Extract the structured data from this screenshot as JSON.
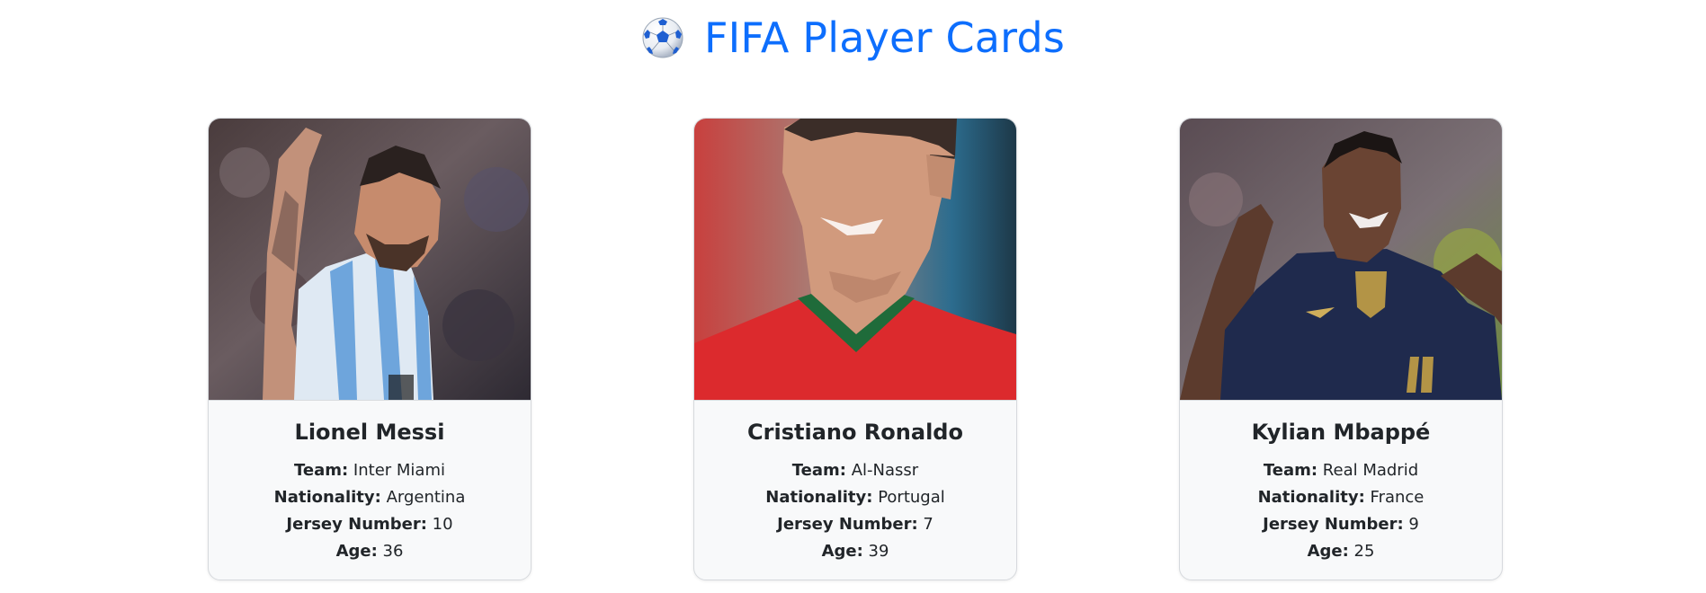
{
  "header": {
    "icon": "soccer-ball-icon",
    "title": "FIFA Player Cards"
  },
  "labels": {
    "team": "Team:",
    "nationality": "Nationality:",
    "jersey": "Jersey Number:",
    "age": "Age:"
  },
  "players": [
    {
      "name": "Lionel Messi",
      "team": "Inter Miami",
      "nationality": "Argentina",
      "jersey_number": "10",
      "age": "36",
      "photo_icon": "player-photo-messi"
    },
    {
      "name": "Cristiano Ronaldo",
      "team": "Al-Nassr",
      "nationality": "Portugal",
      "jersey_number": "7",
      "age": "39",
      "photo_icon": "player-photo-ronaldo"
    },
    {
      "name": "Kylian Mbappé",
      "team": "Real Madrid",
      "nationality": "France",
      "jersey_number": "9",
      "age": "25",
      "photo_icon": "player-photo-mbappe"
    }
  ],
  "colors": {
    "title": "#0d6efd",
    "card_bg": "#f8f9fa",
    "text": "#212529"
  }
}
